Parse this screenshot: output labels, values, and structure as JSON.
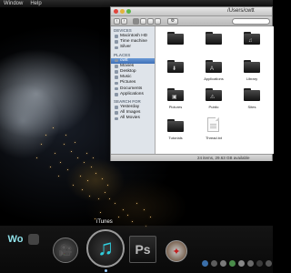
{
  "menubar": {
    "items": [
      "Window",
      "Help"
    ]
  },
  "finder": {
    "title": "/Users/cwtt",
    "sidebar": {
      "sections": [
        {
          "title": "DEVICES",
          "items": [
            "Macintosh HD",
            "Time machine",
            "Silver"
          ]
        },
        {
          "title": "PLACES",
          "items": [
            "cwtt",
            "Movies",
            "Desktop",
            "Music",
            "Pictures",
            "Documents",
            "Applications"
          ],
          "selected": 0
        },
        {
          "title": "SEARCH FOR",
          "items": [
            "Yesterday",
            "All Images",
            "All Movies"
          ]
        }
      ]
    },
    "files": [
      {
        "label": "",
        "kind": "folder",
        "glyph": ""
      },
      {
        "label": "",
        "kind": "folder",
        "glyph": ""
      },
      {
        "label": "",
        "kind": "folder",
        "glyph": "♫"
      },
      {
        "label": "",
        "kind": "folder",
        "glyph": "⬇"
      },
      {
        "label": "Applications",
        "kind": "folder",
        "glyph": "A"
      },
      {
        "label": "Library",
        "kind": "folder",
        "glyph": ""
      },
      {
        "label": "Pictures",
        "kind": "folder",
        "glyph": "▣"
      },
      {
        "label": "Public",
        "kind": "folder",
        "glyph": "⚠"
      },
      {
        "label": "Sites",
        "kind": "folder",
        "glyph": ""
      },
      {
        "label": "Tutorials",
        "kind": "folder",
        "glyph": ""
      },
      {
        "label": "Thread.txt",
        "kind": "document",
        "glyph": ""
      }
    ],
    "status": "24 items, 29.63 GB available"
  },
  "dock": {
    "hover_label": "iTunes",
    "apps": [
      {
        "name": "movie",
        "glyph": "🎥",
        "color": "#2a2a2a"
      },
      {
        "name": "itunes",
        "glyph": "♫",
        "color": "#1c1c1c"
      },
      {
        "name": "photoshop",
        "glyph": "Ps",
        "color": "#1b1b1b"
      },
      {
        "name": "safari",
        "glyph": "✦",
        "color": "#3a2a1a"
      }
    ],
    "left_letters": "Wo",
    "accent": "#2fd0e0"
  }
}
